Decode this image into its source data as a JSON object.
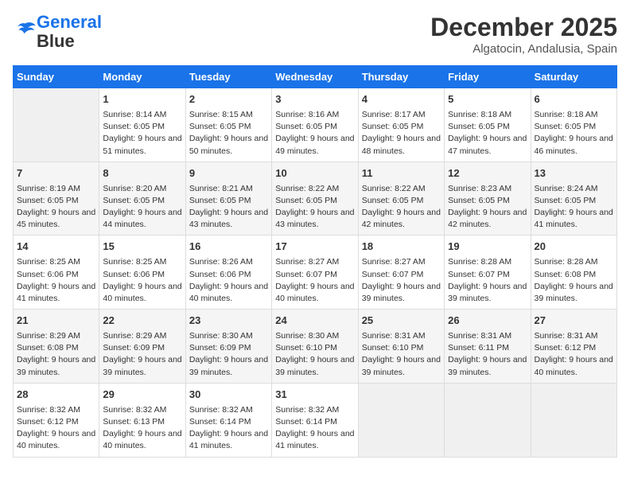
{
  "header": {
    "logo_line1": "General",
    "logo_line2": "Blue",
    "month": "December 2025",
    "location": "Algatocin, Andalusia, Spain"
  },
  "weekdays": [
    "Sunday",
    "Monday",
    "Tuesday",
    "Wednesday",
    "Thursday",
    "Friday",
    "Saturday"
  ],
  "weeks": [
    [
      {
        "day": "",
        "sunrise": "",
        "sunset": "",
        "daylight": ""
      },
      {
        "day": "1",
        "sunrise": "Sunrise: 8:14 AM",
        "sunset": "Sunset: 6:05 PM",
        "daylight": "Daylight: 9 hours and 51 minutes."
      },
      {
        "day": "2",
        "sunrise": "Sunrise: 8:15 AM",
        "sunset": "Sunset: 6:05 PM",
        "daylight": "Daylight: 9 hours and 50 minutes."
      },
      {
        "day": "3",
        "sunrise": "Sunrise: 8:16 AM",
        "sunset": "Sunset: 6:05 PM",
        "daylight": "Daylight: 9 hours and 49 minutes."
      },
      {
        "day": "4",
        "sunrise": "Sunrise: 8:17 AM",
        "sunset": "Sunset: 6:05 PM",
        "daylight": "Daylight: 9 hours and 48 minutes."
      },
      {
        "day": "5",
        "sunrise": "Sunrise: 8:18 AM",
        "sunset": "Sunset: 6:05 PM",
        "daylight": "Daylight: 9 hours and 47 minutes."
      },
      {
        "day": "6",
        "sunrise": "Sunrise: 8:18 AM",
        "sunset": "Sunset: 6:05 PM",
        "daylight": "Daylight: 9 hours and 46 minutes."
      }
    ],
    [
      {
        "day": "7",
        "sunrise": "Sunrise: 8:19 AM",
        "sunset": "Sunset: 6:05 PM",
        "daylight": "Daylight: 9 hours and 45 minutes."
      },
      {
        "day": "8",
        "sunrise": "Sunrise: 8:20 AM",
        "sunset": "Sunset: 6:05 PM",
        "daylight": "Daylight: 9 hours and 44 minutes."
      },
      {
        "day": "9",
        "sunrise": "Sunrise: 8:21 AM",
        "sunset": "Sunset: 6:05 PM",
        "daylight": "Daylight: 9 hours and 43 minutes."
      },
      {
        "day": "10",
        "sunrise": "Sunrise: 8:22 AM",
        "sunset": "Sunset: 6:05 PM",
        "daylight": "Daylight: 9 hours and 43 minutes."
      },
      {
        "day": "11",
        "sunrise": "Sunrise: 8:22 AM",
        "sunset": "Sunset: 6:05 PM",
        "daylight": "Daylight: 9 hours and 42 minutes."
      },
      {
        "day": "12",
        "sunrise": "Sunrise: 8:23 AM",
        "sunset": "Sunset: 6:05 PM",
        "daylight": "Daylight: 9 hours and 42 minutes."
      },
      {
        "day": "13",
        "sunrise": "Sunrise: 8:24 AM",
        "sunset": "Sunset: 6:05 PM",
        "daylight": "Daylight: 9 hours and 41 minutes."
      }
    ],
    [
      {
        "day": "14",
        "sunrise": "Sunrise: 8:25 AM",
        "sunset": "Sunset: 6:06 PM",
        "daylight": "Daylight: 9 hours and 41 minutes."
      },
      {
        "day": "15",
        "sunrise": "Sunrise: 8:25 AM",
        "sunset": "Sunset: 6:06 PM",
        "daylight": "Daylight: 9 hours and 40 minutes."
      },
      {
        "day": "16",
        "sunrise": "Sunrise: 8:26 AM",
        "sunset": "Sunset: 6:06 PM",
        "daylight": "Daylight: 9 hours and 40 minutes."
      },
      {
        "day": "17",
        "sunrise": "Sunrise: 8:27 AM",
        "sunset": "Sunset: 6:07 PM",
        "daylight": "Daylight: 9 hours and 40 minutes."
      },
      {
        "day": "18",
        "sunrise": "Sunrise: 8:27 AM",
        "sunset": "Sunset: 6:07 PM",
        "daylight": "Daylight: 9 hours and 39 minutes."
      },
      {
        "day": "19",
        "sunrise": "Sunrise: 8:28 AM",
        "sunset": "Sunset: 6:07 PM",
        "daylight": "Daylight: 9 hours and 39 minutes."
      },
      {
        "day": "20",
        "sunrise": "Sunrise: 8:28 AM",
        "sunset": "Sunset: 6:08 PM",
        "daylight": "Daylight: 9 hours and 39 minutes."
      }
    ],
    [
      {
        "day": "21",
        "sunrise": "Sunrise: 8:29 AM",
        "sunset": "Sunset: 6:08 PM",
        "daylight": "Daylight: 9 hours and 39 minutes."
      },
      {
        "day": "22",
        "sunrise": "Sunrise: 8:29 AM",
        "sunset": "Sunset: 6:09 PM",
        "daylight": "Daylight: 9 hours and 39 minutes."
      },
      {
        "day": "23",
        "sunrise": "Sunrise: 8:30 AM",
        "sunset": "Sunset: 6:09 PM",
        "daylight": "Daylight: 9 hours and 39 minutes."
      },
      {
        "day": "24",
        "sunrise": "Sunrise: 8:30 AM",
        "sunset": "Sunset: 6:10 PM",
        "daylight": "Daylight: 9 hours and 39 minutes."
      },
      {
        "day": "25",
        "sunrise": "Sunrise: 8:31 AM",
        "sunset": "Sunset: 6:10 PM",
        "daylight": "Daylight: 9 hours and 39 minutes."
      },
      {
        "day": "26",
        "sunrise": "Sunrise: 8:31 AM",
        "sunset": "Sunset: 6:11 PM",
        "daylight": "Daylight: 9 hours and 39 minutes."
      },
      {
        "day": "27",
        "sunrise": "Sunrise: 8:31 AM",
        "sunset": "Sunset: 6:12 PM",
        "daylight": "Daylight: 9 hours and 40 minutes."
      }
    ],
    [
      {
        "day": "28",
        "sunrise": "Sunrise: 8:32 AM",
        "sunset": "Sunset: 6:12 PM",
        "daylight": "Daylight: 9 hours and 40 minutes."
      },
      {
        "day": "29",
        "sunrise": "Sunrise: 8:32 AM",
        "sunset": "Sunset: 6:13 PM",
        "daylight": "Daylight: 9 hours and 40 minutes."
      },
      {
        "day": "30",
        "sunrise": "Sunrise: 8:32 AM",
        "sunset": "Sunset: 6:14 PM",
        "daylight": "Daylight: 9 hours and 41 minutes."
      },
      {
        "day": "31",
        "sunrise": "Sunrise: 8:32 AM",
        "sunset": "Sunset: 6:14 PM",
        "daylight": "Daylight: 9 hours and 41 minutes."
      },
      {
        "day": "",
        "sunrise": "",
        "sunset": "",
        "daylight": ""
      },
      {
        "day": "",
        "sunrise": "",
        "sunset": "",
        "daylight": ""
      },
      {
        "day": "",
        "sunrise": "",
        "sunset": "",
        "daylight": ""
      }
    ]
  ]
}
